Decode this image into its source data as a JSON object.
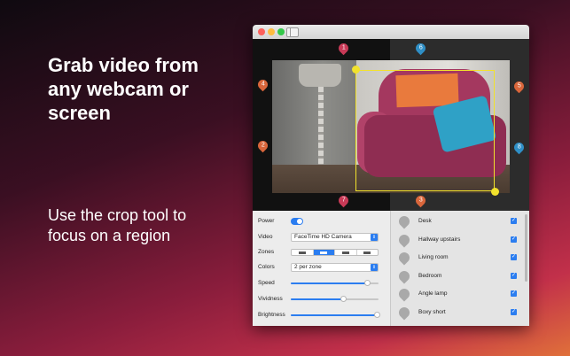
{
  "promo": {
    "headline": "Grab video from any webcam or screen",
    "subline": "Use the crop tool to focus on a region"
  },
  "pins": [
    {
      "label": "1",
      "color": "#c93a57"
    },
    {
      "label": "6",
      "color": "#2f8fc6"
    },
    {
      "label": "4",
      "color": "#d9663b"
    },
    {
      "label": "5",
      "color": "#d9663b"
    },
    {
      "label": "2",
      "color": "#d9663b"
    },
    {
      "label": "8",
      "color": "#2f8fc6"
    },
    {
      "label": "7",
      "color": "#c93a57"
    },
    {
      "label": "3",
      "color": "#d9663b"
    }
  ],
  "controls": {
    "power_label": "Power",
    "power_on": true,
    "video_label": "Video",
    "video_value": "FaceTime HD Camera",
    "zones_label": "Zones",
    "zones_selected": 2,
    "colors_label": "Colors",
    "colors_value": "2 per zone",
    "speed_label": "Speed",
    "speed_value": 0.87,
    "vividness_label": "Vividness",
    "vividness_value": 0.6,
    "brightness_label": "Brightness",
    "brightness_value": 0.98
  },
  "zones": [
    {
      "name": "Desk",
      "checked": true
    },
    {
      "name": "Hallway upstairs",
      "checked": true
    },
    {
      "name": "Living room",
      "checked": true
    },
    {
      "name": "Bedroom",
      "checked": true
    },
    {
      "name": "Angle lamp",
      "checked": true
    },
    {
      "name": "Boxy short",
      "checked": true
    }
  ],
  "colors": {
    "accent": "#2b7df0",
    "crop": "#f2e22c"
  }
}
